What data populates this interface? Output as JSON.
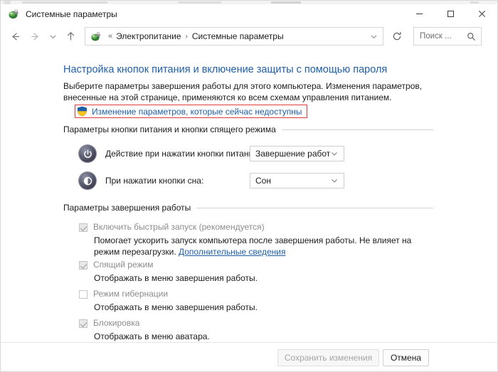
{
  "window": {
    "title": "Системные параметры",
    "title_icon": "power-plug-icon",
    "controls": {
      "minimize": "minimize-icon",
      "maximize": "maximize-icon",
      "close": "close-icon"
    }
  },
  "nav": {
    "back": "back-arrow-icon",
    "forward": "forward-arrow-icon",
    "recent": "chevron-down-icon",
    "up": "up-arrow-icon",
    "refresh": "refresh-icon"
  },
  "address": {
    "icon": "power-plug-icon",
    "prefix": "«",
    "crumbs": [
      "Электропитание",
      "Системные параметры"
    ],
    "separator": "›",
    "caret": "chevron-down-icon"
  },
  "search": {
    "placeholder": "Поиск ...",
    "icon": "search-icon"
  },
  "page": {
    "title": "Настройка кнопок питания и включение защиты с помощью пароля",
    "description": "Выберите параметры завершения работы для этого компьютера. Изменения параметров, внесенные на этой странице, применяются ко всем схемам управления питанием.",
    "uac_link": "Изменение параметров, которые сейчас недоступны",
    "uac_icon": "uac-shield-icon",
    "uac_highlight_color": "#e03a3a",
    "link_color": "#1f5fa8"
  },
  "power_buttons_group": {
    "header": "Параметры кнопки питания и кнопки спящего режима",
    "rows": [
      {
        "icon": "power-button-icon",
        "label": "Действие при нажатии кнопки питания:",
        "value": "Завершение работы"
      },
      {
        "icon": "sleep-button-icon",
        "label": "При нажатии кнопки сна:",
        "value": "Сон"
      }
    ]
  },
  "shutdown_group": {
    "header": "Параметры завершения работы",
    "items": [
      {
        "label": "Включить быстрый запуск (рекомендуется)",
        "checked": true,
        "enabled": false,
        "description_before": "Помогает ускорить запуск компьютера после завершения работы. Не влияет на режим перезагрузки. ",
        "link": "Дополнительные сведения"
      },
      {
        "label": "Спящий режим",
        "checked": true,
        "enabled": false,
        "description_before": "Отображать в меню завершения работы.",
        "link": ""
      },
      {
        "label": "Режим гибернации",
        "checked": false,
        "enabled": false,
        "description_before": "Отображать в меню завершения работы.",
        "link": ""
      },
      {
        "label": "Блокировка",
        "checked": true,
        "enabled": false,
        "description_before": "Отображать в меню аватара.",
        "link": ""
      }
    ]
  },
  "footer": {
    "save_label": "Сохранить изменения",
    "save_enabled": false,
    "cancel_label": "Отмена",
    "cancel_enabled": true
  }
}
